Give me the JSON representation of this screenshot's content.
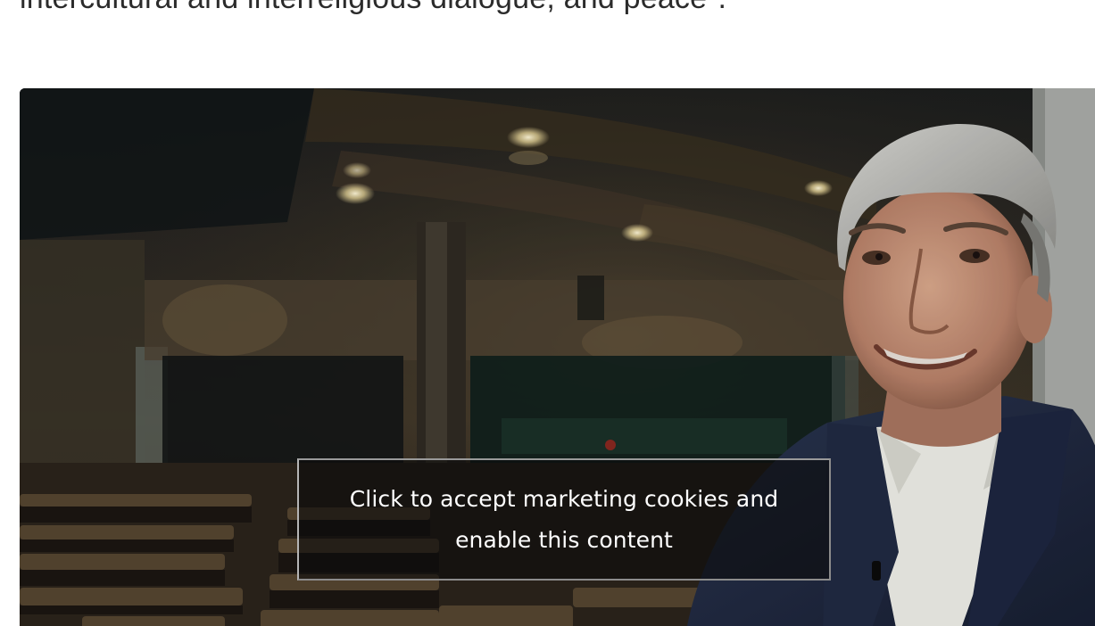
{
  "article": {
    "intro_text": "intercultural and interreligious dialogue, and peace\"."
  },
  "video": {
    "icon": "video-placeholder-icon",
    "cookie_notice": "Click to accept marketing cookies and enable this content"
  }
}
